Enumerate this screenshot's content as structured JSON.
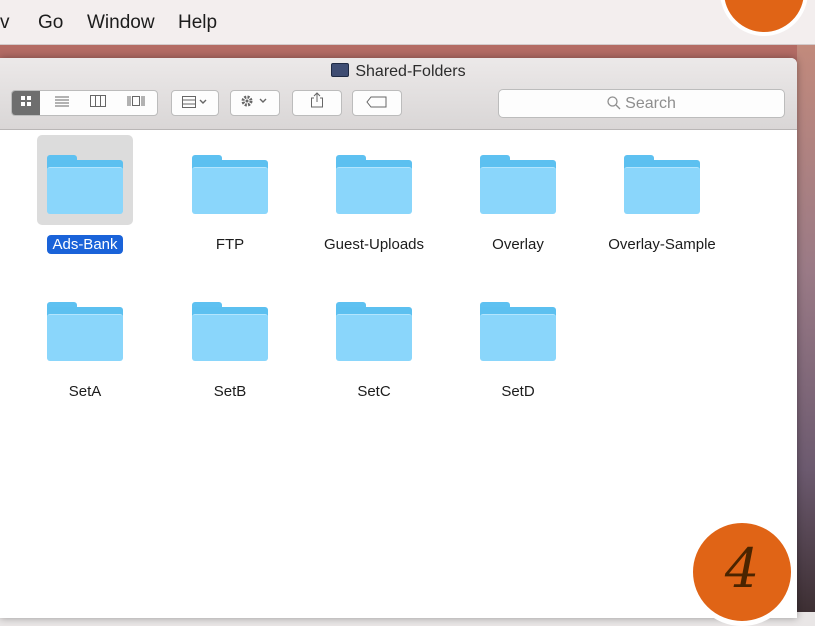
{
  "menubar": {
    "items": [
      "v",
      "Go",
      "Window",
      "Help"
    ]
  },
  "window": {
    "title": "Shared-Folders",
    "toolbar": {
      "view_icons": [
        "icon-view-icon",
        "list-view-icon",
        "column-view-icon",
        "cover-flow-icon"
      ],
      "arrange_icon": "arrange-icon",
      "action_icon": "gear-icon",
      "share_icon": "share-icon",
      "tag_icon": "tag-icon",
      "search_placeholder": "Search"
    },
    "items": [
      {
        "name": "Ads-Bank",
        "selected": true
      },
      {
        "name": "FTP",
        "selected": false
      },
      {
        "name": "Guest-Uploads",
        "selected": false
      },
      {
        "name": "Overlay",
        "selected": false
      },
      {
        "name": "Overlay-Sample",
        "selected": false
      },
      {
        "name": "SetA",
        "selected": false
      },
      {
        "name": "SetB",
        "selected": false
      },
      {
        "name": "SetC",
        "selected": false
      },
      {
        "name": "SetD",
        "selected": false
      }
    ]
  },
  "badge": {
    "number": "4",
    "color": "#e06416"
  },
  "colors": {
    "selection": "#1a63d9",
    "folder": "#5cc0f0",
    "folder_front": "#8ad6fb"
  }
}
